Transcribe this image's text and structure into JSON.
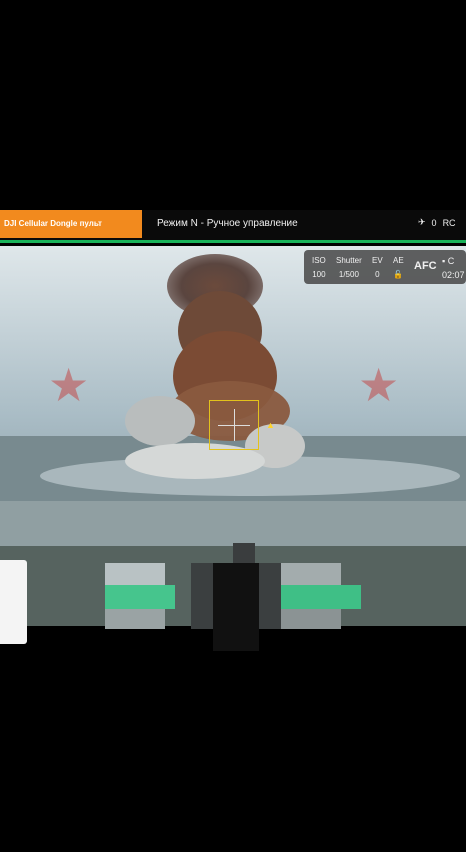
{
  "header": {
    "connection_label": "DJI Cellular Dongle пульт",
    "mode_label": "Режим N - Ручное управление",
    "signal_value": "0",
    "rc_label": "RC"
  },
  "camera_params": {
    "iso_label": "ISO",
    "iso_value": "100",
    "shutter_label": "Shutter",
    "shutter_value": "1/500",
    "ev_label": "EV",
    "ev_value": "0",
    "ae_label": "AE",
    "focus_mode": "AFC",
    "record_label": "C",
    "timer": "02:07"
  },
  "colors": {
    "accent_orange": "#f28a1e",
    "status_green": "#19b35a",
    "reticle_yellow": "#e3c21c"
  },
  "icons": [
    "signal-icon",
    "lock-icon",
    "sd-card-icon",
    "reticle-icon",
    "red-star-icon"
  ]
}
